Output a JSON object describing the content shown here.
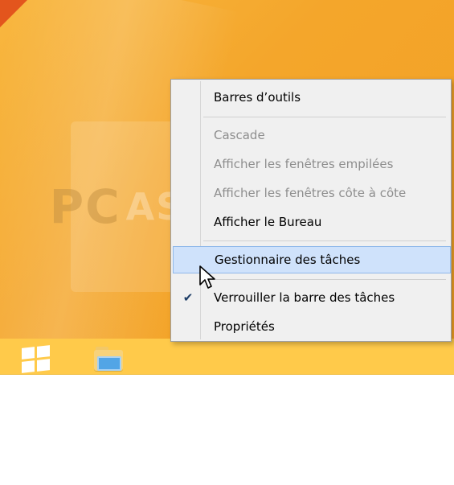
{
  "context_menu": {
    "items": [
      {
        "label": "Barres d’outils"
      },
      {
        "label": "Cascade"
      },
      {
        "label": "Afficher les fenêtres empilées"
      },
      {
        "label": "Afficher les fenêtres côte à côte"
      },
      {
        "label": "Afficher le Bureau"
      },
      {
        "label": "Gestionnaire des tâches"
      },
      {
        "label": "Verrouiller la barre des tâches",
        "check_mark": "✔"
      },
      {
        "label": "Propriétés"
      }
    ]
  },
  "watermark": {
    "text_main": "PC",
    "text_sub": "ASTUCES"
  },
  "taskbar": {
    "start_icon": "windows-logo-icon",
    "pinned_icon": "file-explorer-icon"
  },
  "colors": {
    "desktop_bg": "#f4a62b",
    "taskbar_bg": "#ffca4a",
    "menu_bg": "#f0f0f0",
    "menu_hover": "#cfe2fb",
    "menu_hover_border": "#8fb8ea",
    "text_disabled": "#8e8e8e"
  }
}
